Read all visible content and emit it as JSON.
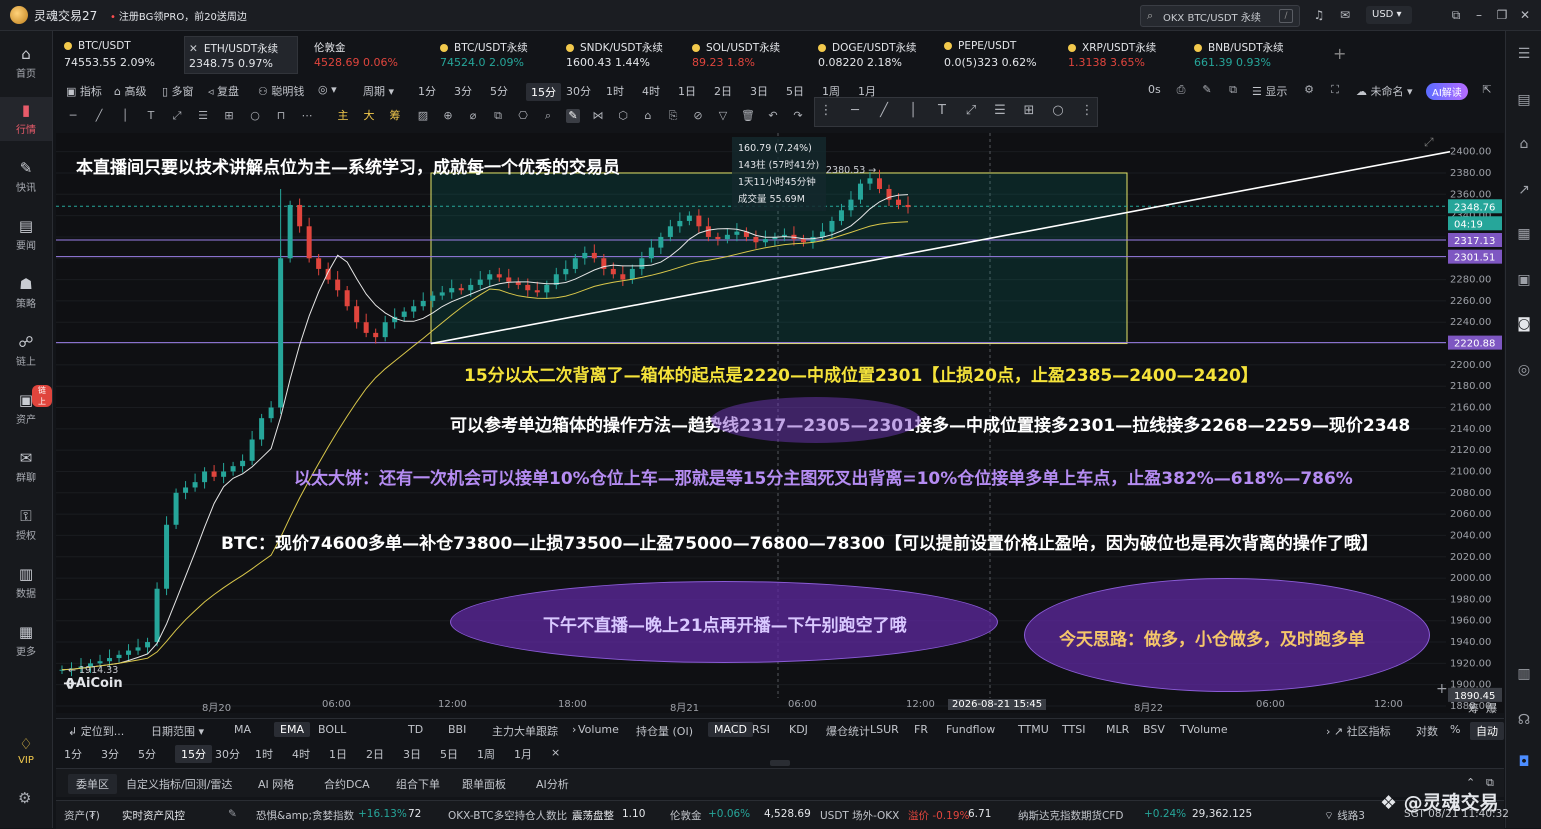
{
  "window": {
    "app_title": "灵魂交易27",
    "notice": "注册BG领PRO，前20送周边",
    "search_text": "OKX BTC/USDT 永续",
    "search_shortcut": "/",
    "currency": "USD"
  },
  "sidebar": {
    "items": [
      {
        "label": "首页",
        "icon": "home-icon"
      },
      {
        "label": "行情",
        "icon": "chart-bars-icon",
        "active": true
      },
      {
        "label": "快讯",
        "icon": "news-icon"
      },
      {
        "label": "要闻",
        "icon": "document-icon"
      },
      {
        "label": "策略",
        "icon": "robot-icon"
      },
      {
        "label": "链上",
        "icon": "chain-icon"
      },
      {
        "label": "资产",
        "icon": "wallet-icon",
        "badge": "链上"
      },
      {
        "label": "群聊",
        "icon": "chat-icon"
      },
      {
        "label": "授权",
        "icon": "key-icon"
      },
      {
        "label": "数据",
        "icon": "data-icon"
      },
      {
        "label": "更多",
        "icon": "grid-icon"
      },
      {
        "label": "VIP",
        "icon": "vip-icon"
      }
    ]
  },
  "tickers": [
    {
      "name": "BTC/USDT",
      "price": "74553.55",
      "change": "2.09%",
      "color": "#e4e6ea"
    },
    {
      "name": "ETH/USDT永续",
      "price": "2348.75",
      "change": "0.97%",
      "color": "#e4e6ea",
      "selected": true
    },
    {
      "name": "伦敦金",
      "price": "4528.69",
      "change": "0.06%",
      "color": "#e0453d"
    },
    {
      "name": "BTC/USDT永续",
      "price": "74524.0",
      "change": "2.09%",
      "color": "#26a69a"
    },
    {
      "name": "SNDK/USDT永续",
      "price": "1600.43",
      "change": "1.44%",
      "color": "#e4e6ea"
    },
    {
      "name": "SOL/USDT永续",
      "price": "89.23",
      "change": "1.8%",
      "color": "#e0453d"
    },
    {
      "name": "DOGE/USDT永续",
      "price": "0.08220",
      "change": "2.18%",
      "color": "#e4e6ea"
    },
    {
      "name": "PEPE/USDT",
      "price": "0.0(5)323",
      "change": "0.62%",
      "color": "#e4e6ea"
    },
    {
      "name": "XRP/USDT永续",
      "price": "1.3138",
      "change": "3.65%",
      "color": "#e0453d"
    },
    {
      "name": "BNB/USDT永续",
      "price": "661.39",
      "change": "0.93%",
      "color": "#26a69a"
    }
  ],
  "toolbar": {
    "left": [
      "指标",
      "高级",
      "多窗",
      "复盘",
      "聪明钱",
      "周期"
    ],
    "timeframes": [
      "1分",
      "3分",
      "5分",
      "15分",
      "30分",
      "1时",
      "4时",
      "1日",
      "2日",
      "3日",
      "5日",
      "1周",
      "1月"
    ],
    "selected_tf": "15分",
    "right": [
      "0s",
      "显示",
      "未命名",
      "AI解读"
    ]
  },
  "drawing_tools": [
    "主",
    "大",
    "筹"
  ],
  "chart": {
    "tooltip": [
      "160.79 (7.24%)",
      "143柱 (57时41分)",
      "1天11小时45分钟",
      "成交量 55.69M"
    ],
    "high_label": "2380.53",
    "low_label": "1914.33",
    "watermark": "AiCoin",
    "price_ticks": [
      "2400.00",
      "2380.00",
      "2360.00",
      "2340.00",
      "2320.00",
      "2300.00",
      "2280.00",
      "2260.00",
      "2240.00",
      "2220.00",
      "2200.00",
      "2180.00",
      "2160.00",
      "2140.00",
      "2120.00",
      "2100.00",
      "2080.00",
      "2060.00",
      "2040.00",
      "2020.00",
      "2000.00",
      "1980.00",
      "1960.00",
      "1940.00",
      "1920.00",
      "1900.00",
      "1880.00"
    ],
    "price_tags": [
      {
        "text": "2348.76",
        "bg": "#26a69a"
      },
      {
        "text": "04:19",
        "bg": "#26a69a"
      },
      {
        "text": "2317.13",
        "bg": "#7e57c2"
      },
      {
        "text": "2301.51",
        "bg": "#7e57c2"
      },
      {
        "text": "2220.88",
        "bg": "#7e57c2"
      },
      {
        "text": "1890.45",
        "bg": "#3a3d44"
      }
    ],
    "time_ticks": [
      "8月20",
      "06:00",
      "12:00",
      "18:00",
      "8月21",
      "06:00",
      "12:00",
      "8月22",
      "06:00",
      "12:00"
    ],
    "crosshair_time": "2026-08-21 15:45",
    "axis_buttons": [
      "筹",
      "爆"
    ]
  },
  "annotations": {
    "line1": "本直播间只要以技术讲解点位为主—系统学习，成就每一个优秀的交易员",
    "line2": "15分以太二次背离了—箱体的起点是2220—中成位置2301【止损20点，止盈2385—2400—2420】",
    "line3": "可以参考单边箱体的操作方法—趋势线2317—2305—2301接多—中成位置接多2301—拉线接多2268—2259—现价2348",
    "line4": "以太大饼：还有一次机会可以接单10%仓位上车—那就是等15分主图死叉出背离=10%仓位接单多单上车点，止盈382%—618%—786%",
    "line5": "BTC：现价74600多单—补仓73800—止损73500—止盈75000—76800—78300【可以提前设置价格止盈哈，因为破位也是再次背离的操作了哦】",
    "bubble1": "下午不直播—晚上21点再开播—下午别跑空了哦",
    "bubble2": "今天思路：做多，小仓做多，及时跑多单"
  },
  "indicators": {
    "left": [
      "定位到...",
      "日期范围"
    ],
    "main": [
      "MA",
      "EMA",
      "BOLL",
      "TD",
      "BBI",
      "主力大单跟踪"
    ],
    "sub": [
      "Volume",
      "持仓量 (OI)",
      "MACD",
      "RSI",
      "KDJ",
      "爆仓统计",
      "LSUR",
      "FR",
      "Fundflow",
      "TTMU",
      "TTSI",
      "MLR",
      "BSV",
      "TVolume"
    ],
    "right": [
      "社区指标",
      "对数",
      "%",
      "自动"
    ],
    "selected_main": "EMA",
    "selected_sub": "MACD"
  },
  "timeframe_bar": [
    "1分",
    "3分",
    "5分",
    "15分",
    "30分",
    "1时",
    "4时",
    "1日",
    "2日",
    "3日",
    "5日",
    "1周",
    "1月"
  ],
  "panel_tabs": [
    "委单区",
    "自定义指标/回测/雷达",
    "AI 网格",
    "合约DCA",
    "组合下单",
    "跟单面板",
    "AI分析"
  ],
  "status": {
    "assets": "资产(₮)",
    "risk": "实时资产风控",
    "fear_label": "恐惧&amp;贪婪指数",
    "fear_change": "+16.13%",
    "fear_value": "72",
    "okx_label": "OKX-BTC多空持仓人数比",
    "okx_state": "震荡盘整",
    "okx_value": "1.10",
    "gold_label": "伦敦金",
    "gold_change": "+0.06%",
    "gold_value": "4,528.69",
    "usdt_label": "USDT 场外-OKX",
    "usdt_change": "溢价 -0.19%",
    "usdt_value": "6.71",
    "nasdaq_label": "纳斯达克指数期货CFD",
    "nasdaq_change": "+0.24%",
    "nasdaq_value": "29,362.125",
    "line": "线路3",
    "clock": "SGT 08/21 11:40:32",
    "watermark": "@灵魂交易"
  },
  "chart_data": {
    "type": "candlestick",
    "symbol": "ETH/USDT永续",
    "interval": "15分",
    "y_range": [
      1880,
      2410
    ],
    "levels": [
      2317.13,
      2301.51,
      2220.88
    ],
    "box": {
      "low": 2220,
      "high": 2380
    },
    "trendline": {
      "from": 2220,
      "to": 2400
    },
    "last_price": 2348.76,
    "close_path": [
      1914,
      1915,
      1917,
      1920,
      1922,
      1925,
      1928,
      1932,
      1935,
      1940,
      1990,
      2050,
      2080,
      2085,
      2090,
      2100,
      2095,
      2100,
      2105,
      2110,
      2130,
      2150,
      2160,
      2300,
      2350,
      2330,
      2300,
      2290,
      2280,
      2270,
      2255,
      2240,
      2230,
      2226,
      2240,
      2245,
      2250,
      2255,
      2260,
      2265,
      2268,
      2272,
      2270,
      2275,
      2280,
      2285,
      2282,
      2278,
      2275,
      2270,
      2268,
      2275,
      2285,
      2290,
      2300,
      2305,
      2300,
      2290,
      2285,
      2280,
      2290,
      2300,
      2310,
      2320,
      2330,
      2335,
      2340,
      2330,
      2320,
      2318,
      2322,
      2325,
      2320,
      2315,
      2318,
      2320,
      2322,
      2318,
      2315,
      2320,
      2325,
      2335,
      2345,
      2355,
      2370,
      2375,
      2365,
      2355,
      2350,
      2348
    ]
  }
}
